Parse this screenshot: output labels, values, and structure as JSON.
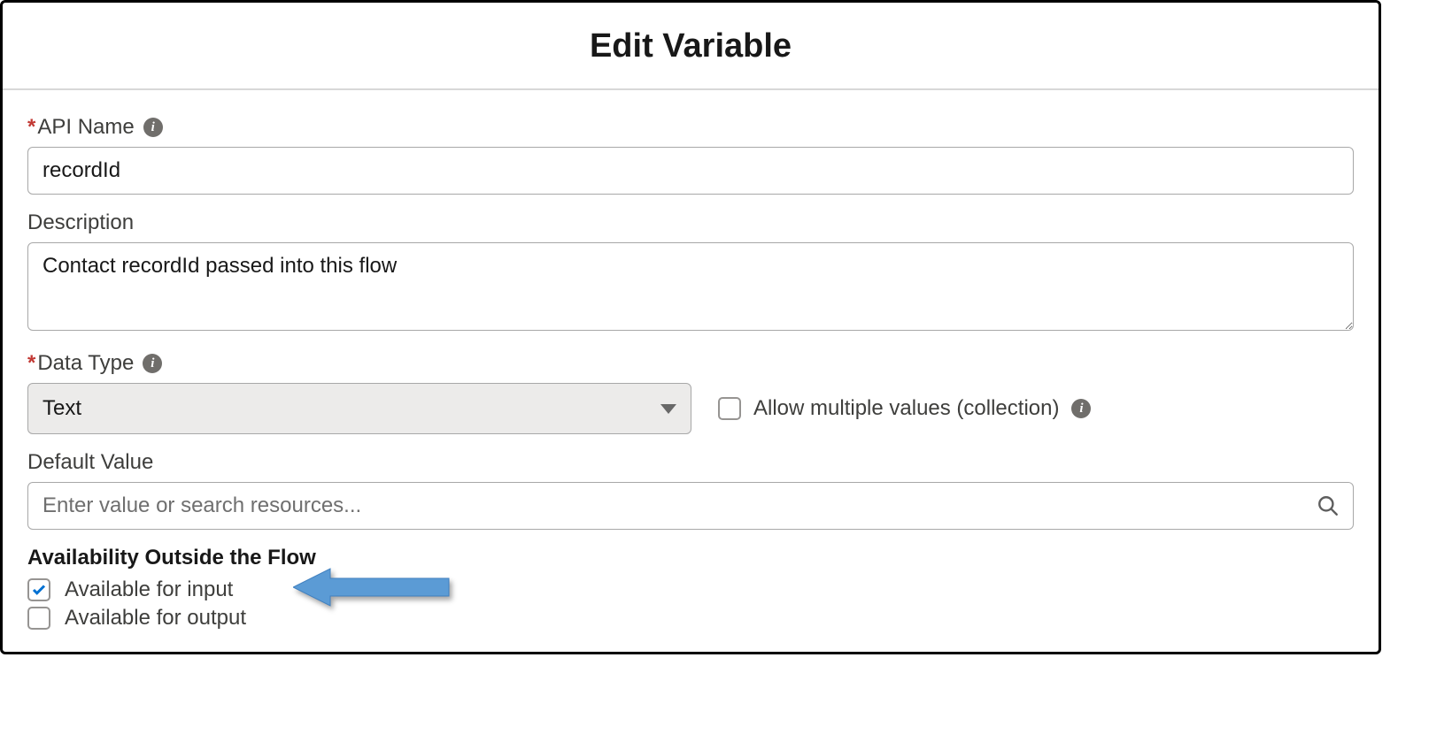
{
  "dialog": {
    "title": "Edit Variable"
  },
  "fields": {
    "api_name": {
      "label": "API Name",
      "value": "recordId"
    },
    "description": {
      "label": "Description",
      "value": "Contact recordId passed into this flow"
    },
    "data_type": {
      "label": "Data Type",
      "value": "Text"
    },
    "allow_multiple": {
      "label": "Allow multiple values (collection)",
      "checked": false
    },
    "default_value": {
      "label": "Default Value",
      "placeholder": "Enter value or search resources...",
      "value": ""
    }
  },
  "availability": {
    "heading": "Availability Outside the Flow",
    "input": {
      "label": "Available for input",
      "checked": true
    },
    "output": {
      "label": "Available for output",
      "checked": false
    }
  },
  "icons": {
    "info": "i"
  },
  "colors": {
    "required": "#c23934",
    "arrow": "#5b9bd5"
  }
}
